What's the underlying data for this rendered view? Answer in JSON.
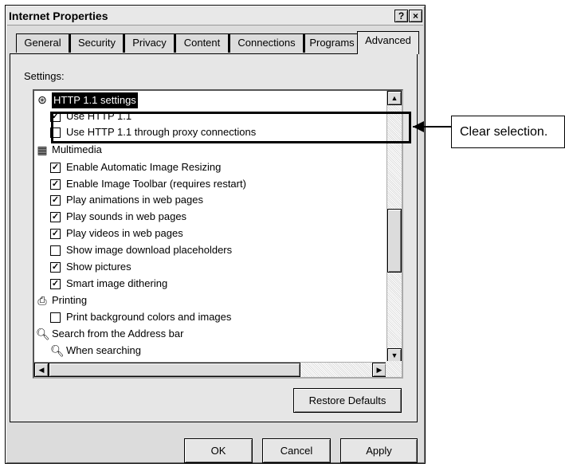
{
  "window": {
    "title": "Internet Properties",
    "help_glyph": "?",
    "close_glyph": "×"
  },
  "tabs": [
    {
      "label": "General"
    },
    {
      "label": "Security"
    },
    {
      "label": "Privacy"
    },
    {
      "label": "Content"
    },
    {
      "label": "Connections"
    },
    {
      "label": "Programs"
    },
    {
      "label": "Advanced"
    }
  ],
  "active_tab": "Advanced",
  "settings_label": "Settings:",
  "tree": {
    "items": [
      {
        "type": "category",
        "icon": "globe-icon",
        "label": "HTTP 1.1 settings",
        "selected": true
      },
      {
        "type": "option",
        "checked": true,
        "label": "Use HTTP 1.1"
      },
      {
        "type": "option",
        "checked": false,
        "label": "Use HTTP 1.1 through proxy connections"
      },
      {
        "type": "category",
        "icon": "multimedia-icon",
        "label": "Multimedia"
      },
      {
        "type": "option",
        "checked": true,
        "label": "Enable Automatic Image Resizing"
      },
      {
        "type": "option",
        "checked": true,
        "label": "Enable Image Toolbar (requires restart)"
      },
      {
        "type": "option",
        "checked": true,
        "label": "Play animations in web pages"
      },
      {
        "type": "option",
        "checked": true,
        "label": "Play sounds in web pages"
      },
      {
        "type": "option",
        "checked": true,
        "label": "Play videos in web pages"
      },
      {
        "type": "option",
        "checked": false,
        "label": "Show image download placeholders"
      },
      {
        "type": "option",
        "checked": true,
        "label": "Show pictures"
      },
      {
        "type": "option",
        "checked": true,
        "label": "Smart image dithering"
      },
      {
        "type": "category",
        "icon": "printer-icon",
        "label": "Printing"
      },
      {
        "type": "option",
        "checked": false,
        "label": "Print background colors and images"
      },
      {
        "type": "category",
        "icon": "magnifier-icon",
        "label": "Search from the Address bar"
      },
      {
        "type": "subcategory",
        "icon": "magnifier-icon",
        "label": "When searching"
      }
    ]
  },
  "buttons": {
    "restore_defaults": "Restore Defaults",
    "ok": "OK",
    "cancel": "Cancel",
    "apply": "Apply"
  },
  "callout": {
    "text": "Clear selection."
  }
}
